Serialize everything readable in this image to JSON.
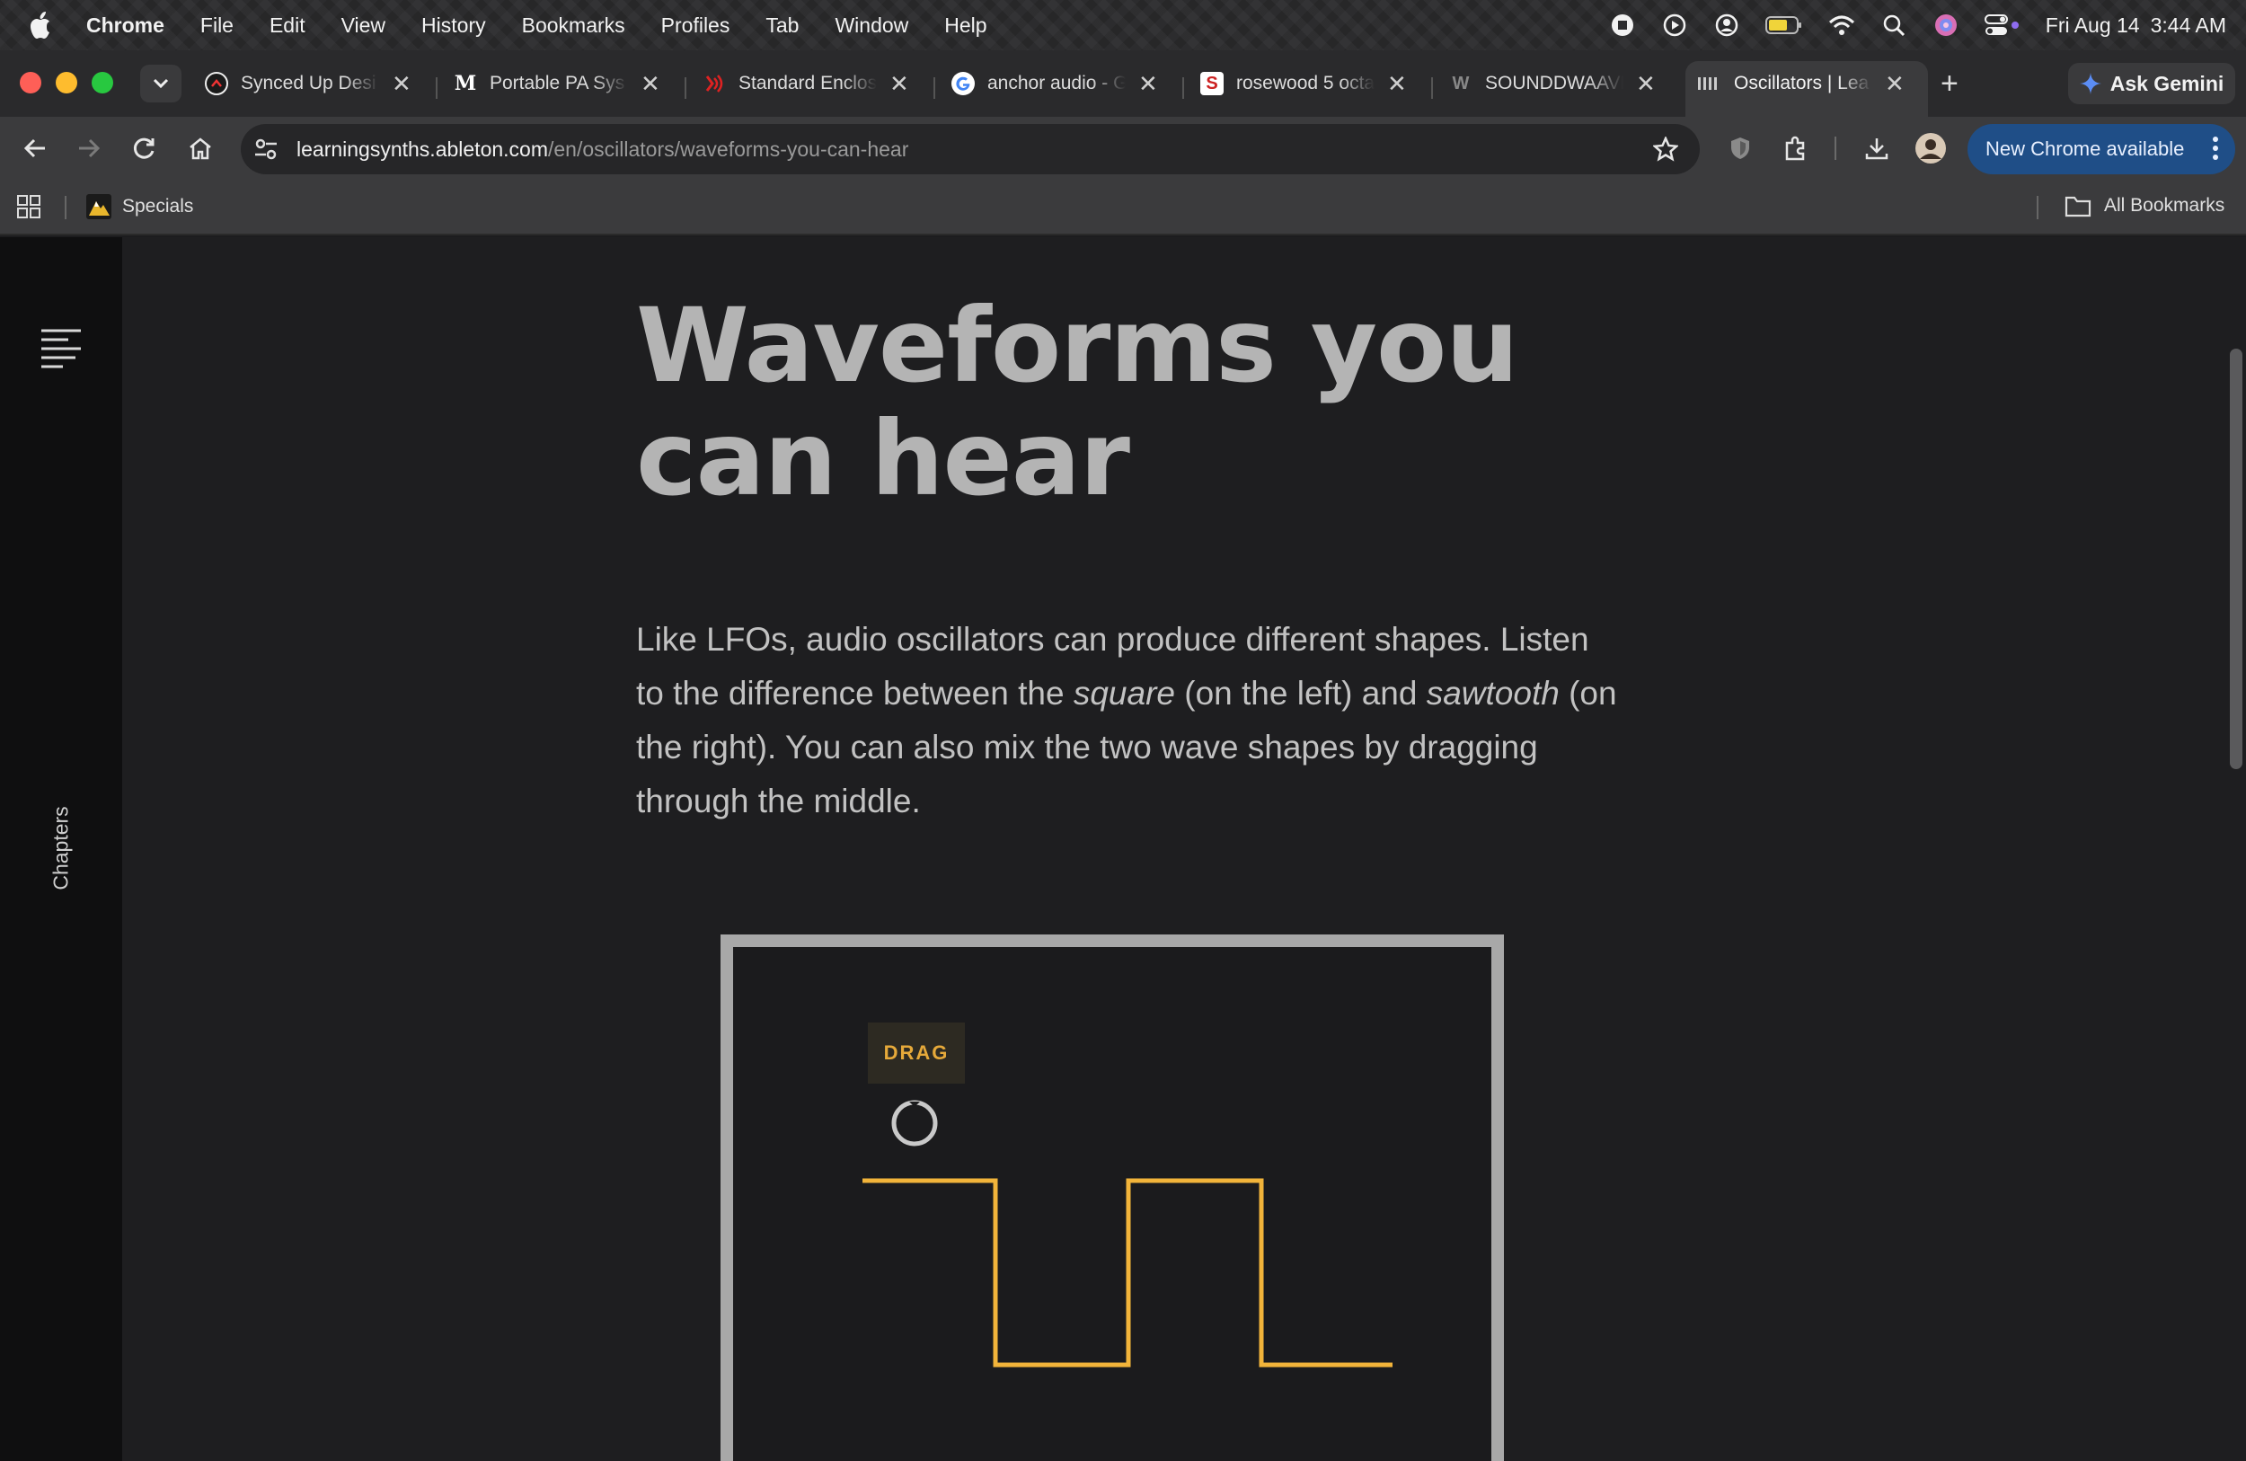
{
  "menubar": {
    "app": "Chrome",
    "items": [
      "File",
      "Edit",
      "View",
      "History",
      "Bookmarks",
      "Profiles",
      "Tab",
      "Window",
      "Help"
    ],
    "date": "Fri Aug 14",
    "time": "3:44 AM"
  },
  "tabs": [
    {
      "title": "Synced Up Desi",
      "icon": "synced-up-favicon"
    },
    {
      "title": "Portable PA Sys",
      "icon": "m-favicon"
    },
    {
      "title": "Standard Enclos",
      "icon": "standard-enclosure-favicon"
    },
    {
      "title": "anchor audio - G",
      "icon": "google-favicon"
    },
    {
      "title": "rosewood 5 octa",
      "icon": "s-favicon"
    },
    {
      "title": "SOUNDDWAAVE",
      "icon": "w-favicon"
    },
    {
      "title": "Oscillators | Lea",
      "icon": "ableton-favicon",
      "active": true
    }
  ],
  "toolbar": {
    "url_host": "learningsynths.ableton.com",
    "url_path": "/en/oscillators/waveforms-you-can-hear",
    "gemini_label": "Ask Gemini",
    "update_label": "New Chrome available"
  },
  "bookmarks": {
    "specials": "Specials",
    "all_bookmarks": "All Bookmarks"
  },
  "sidebar": {
    "chapters_label": "Chapters"
  },
  "article": {
    "title_line1": "Waveforms you",
    "title_line2": "can hear",
    "intro_part1": "Like LFOs, audio oscillators can produce different shapes. Listen to the difference between the ",
    "intro_square": "square",
    "intro_part2": " (on the left) and ",
    "intro_sawtooth": "sawtooth",
    "intro_part3": " (on the right). You can also mix the two wave shapes by dragging through the middle."
  },
  "demo": {
    "drag_label": "DRAG",
    "wave_color": "#f2b43a",
    "shape_mix": 0
  },
  "colors": {
    "accent": "#f2b43a",
    "update_button": "#1f4e87"
  }
}
